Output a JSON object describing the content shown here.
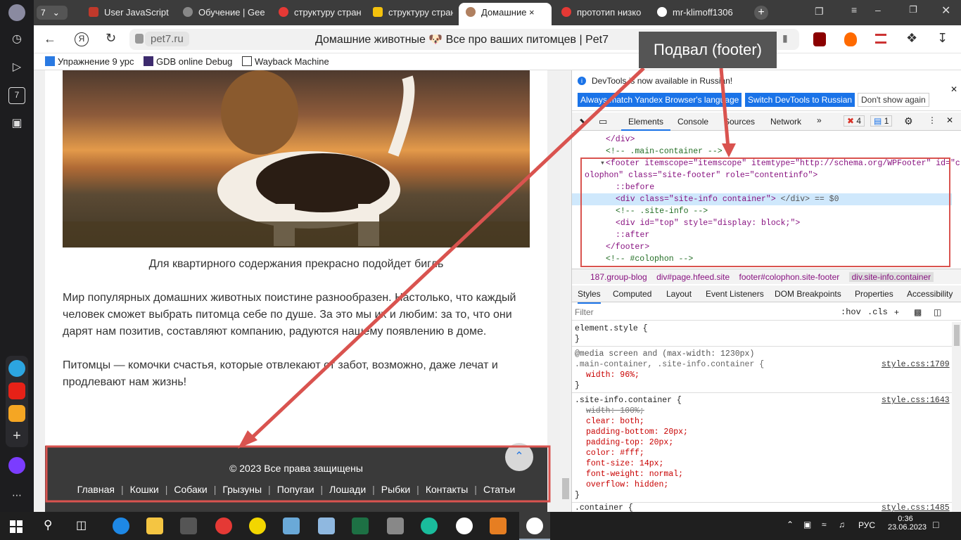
{
  "browser": {
    "tab_count": "7",
    "tabs": [
      {
        "label": "User JavaScript",
        "color": "#c0392b"
      },
      {
        "label": "Обучение | Gee",
        "color": "#888888"
      },
      {
        "label": "структуру стран",
        "color": "#e53935"
      },
      {
        "label": "структуру стран",
        "color": "#f4c20d"
      },
      {
        "label": "Домашние ×",
        "color": "#b08060"
      },
      {
        "label": "прототип низко",
        "color": "#e53935"
      },
      {
        "label": "mr-klimoff1306",
        "color": "#ffffff"
      }
    ],
    "address": "pet7.ru",
    "page_title": "Домашние животные 🐶 Все про ваших питомцев | Pet7",
    "bookmarks": [
      "Упражнение 9 урс",
      "GDB online Debug",
      "Wayback Machine"
    ]
  },
  "sidebar_badge": "7",
  "page": {
    "caption": "Для квартирного содержания прекрасно подойдет бигль",
    "paragraph1": "Мир популярных домашних животных поистине разнообразен. Настолько, что каждый человек сможет выбрать питомца себе по душе. За это мы их и любим: за то, что они дарят нам позитив, составляют компанию, радуются нашему появлению в доме.",
    "paragraph2": "Питомцы — комочки счастья, которые отвлекают от забот, возможно, даже лечат и продлевают нам жизнь!",
    "footer_copyright": "© 2023 Все права защищены",
    "footer_nav": [
      "Главная",
      "Кошки",
      "Собаки",
      "Грызуны",
      "Попугаи",
      "Лошади",
      "Рыбки",
      "Контакты",
      "Статьи"
    ]
  },
  "annotation": {
    "label": "Подвал (footer)",
    "color": "#d9534f"
  },
  "devtools": {
    "banner_text": "DevTools is now available in Russian!",
    "banner_btn1": "Always match Yandex Browser's language",
    "banner_btn2": "Switch DevTools to Russian",
    "banner_btn3": "Don't show again",
    "tabs": [
      "Elements",
      "Console",
      "Sources",
      "Network"
    ],
    "errors": "4",
    "messages": "1",
    "dom": [
      "</div>",
      "<!-- .main-container -->",
      "<footer itemscope=\"itemscope\" itemtype=\"http://schema.org/WPFooter\" id=\"c",
      "olophon\" class=\"site-footer\" role=\"contentinfo\">",
      "::before",
      "<div class=\"site-info container\">",
      "<!-- .site-info -->",
      "<div id=\"top\" style=\"display: block;\">",
      "::after",
      "</footer>",
      "<!-- #colophon -->"
    ],
    "selected_suffix": "</div> == $0",
    "breadcrumb": [
      "187.group-blog",
      "div#page.hfeed.site",
      "footer#colophon.site-footer",
      "div.site-info.container"
    ],
    "styles_tabs": [
      "Styles",
      "Computed",
      "Layout",
      "Event Listeners",
      "DOM Breakpoints",
      "Properties",
      "Accessibility"
    ],
    "filter_placeholder": "Filter",
    "hov": ":hov",
    "cls": ".cls",
    "rules": {
      "element_style": "element.style {",
      "media": "@media screen and (max-width: 1230px)",
      "rule1_selector": ".main-container, .site-info.container {",
      "rule1_source": "style.css:1709",
      "rule1_prop": "width: 96%;",
      "rule2_selector": ".site-info.container {",
      "rule2_source": "style.css:1643",
      "rule2_props": [
        "width: 100%;",
        "clear: both;",
        "padding-bottom: 20px;",
        "padding-top: 20px;",
        "color: #fff;",
        "font-size: 14px;",
        "font-weight: normal;",
        "overflow: hidden;"
      ],
      "rule3_selector": ".container {",
      "rule3_source": "style.css:1485",
      "close": "}"
    }
  },
  "taskbar": {
    "lang": "РУС",
    "time": "0:36",
    "date": "23.06.2023"
  }
}
